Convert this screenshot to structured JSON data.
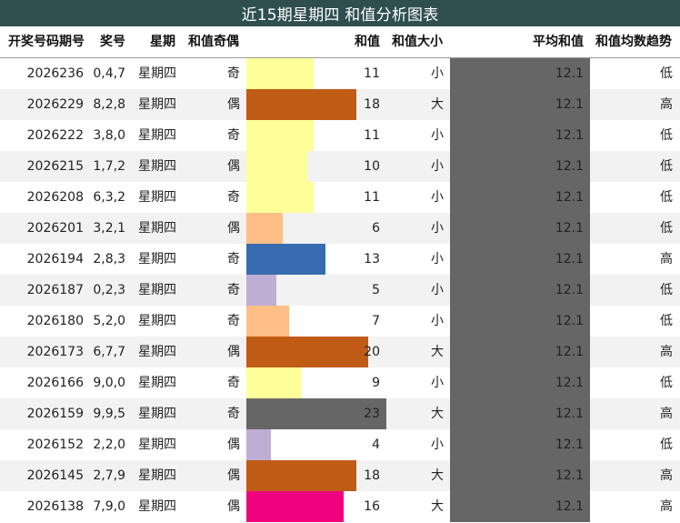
{
  "title": "近15期星期四 和值分析图表",
  "headers": {
    "issue": "开奖号码期号",
    "numbers": "奖号",
    "weekday": "星期",
    "parity": "和值奇偶",
    "sum": "和值",
    "size": "和值大小",
    "avg": "平均和值",
    "trend": "和值均数趋势"
  },
  "colors": {
    "title_bg": "#2f4f4f",
    "avg_bg": "#666666",
    "row_alt": "#f2f2f2"
  },
  "chart_data": {
    "type": "table",
    "title": "近15期星期四 和值分析图表",
    "sum_scale_max": 23,
    "columns": [
      "开奖号码期号",
      "奖号",
      "星期",
      "和值奇偶",
      "和值",
      "和值大小",
      "平均和值",
      "和值均数趋势"
    ],
    "rows": [
      {
        "issue": "2026236",
        "numbers": "0,4,7",
        "weekday": "星期四",
        "parity": "奇",
        "sum": 11,
        "size": "小",
        "avg": "12.1",
        "trend": "低",
        "bar_color": "#ffff99"
      },
      {
        "issue": "2026229",
        "numbers": "8,2,8",
        "weekday": "星期四",
        "parity": "偶",
        "sum": 18,
        "size": "大",
        "avg": "12.1",
        "trend": "高",
        "bar_color": "#c05c16"
      },
      {
        "issue": "2026222",
        "numbers": "3,8,0",
        "weekday": "星期四",
        "parity": "奇",
        "sum": 11,
        "size": "小",
        "avg": "12.1",
        "trend": "低",
        "bar_color": "#ffff99"
      },
      {
        "issue": "2026215",
        "numbers": "1,7,2",
        "weekday": "星期四",
        "parity": "偶",
        "sum": 10,
        "size": "小",
        "avg": "12.1",
        "trend": "低",
        "bar_color": "#ffff99"
      },
      {
        "issue": "2026208",
        "numbers": "6,3,2",
        "weekday": "星期四",
        "parity": "奇",
        "sum": 11,
        "size": "小",
        "avg": "12.1",
        "trend": "低",
        "bar_color": "#ffff99"
      },
      {
        "issue": "2026201",
        "numbers": "3,2,1",
        "weekday": "星期四",
        "parity": "偶",
        "sum": 6,
        "size": "小",
        "avg": "12.1",
        "trend": "低",
        "bar_color": "#fdbf85"
      },
      {
        "issue": "2026194",
        "numbers": "2,8,3",
        "weekday": "星期四",
        "parity": "奇",
        "sum": 13,
        "size": "小",
        "avg": "12.1",
        "trend": "高",
        "bar_color": "#386cb0"
      },
      {
        "issue": "2026187",
        "numbers": "0,2,3",
        "weekday": "星期四",
        "parity": "奇",
        "sum": 5,
        "size": "小",
        "avg": "12.1",
        "trend": "低",
        "bar_color": "#beaed4"
      },
      {
        "issue": "2026180",
        "numbers": "5,2,0",
        "weekday": "星期四",
        "parity": "奇",
        "sum": 7,
        "size": "小",
        "avg": "12.1",
        "trend": "低",
        "bar_color": "#fdbf85"
      },
      {
        "issue": "2026173",
        "numbers": "6,7,7",
        "weekday": "星期四",
        "parity": "偶",
        "sum": 20,
        "size": "大",
        "avg": "12.1",
        "trend": "高",
        "bar_color": "#c05c16"
      },
      {
        "issue": "2026166",
        "numbers": "9,0,0",
        "weekday": "星期四",
        "parity": "奇",
        "sum": 9,
        "size": "小",
        "avg": "12.1",
        "trend": "低",
        "bar_color": "#ffff99"
      },
      {
        "issue": "2026159",
        "numbers": "9,9,5",
        "weekday": "星期四",
        "parity": "奇",
        "sum": 23,
        "size": "大",
        "avg": "12.1",
        "trend": "高",
        "bar_color": "#666666"
      },
      {
        "issue": "2026152",
        "numbers": "2,2,0",
        "weekday": "星期四",
        "parity": "偶",
        "sum": 4,
        "size": "小",
        "avg": "12.1",
        "trend": "低",
        "bar_color": "#beaed4"
      },
      {
        "issue": "2026145",
        "numbers": "2,7,9",
        "weekday": "星期四",
        "parity": "偶",
        "sum": 18,
        "size": "大",
        "avg": "12.1",
        "trend": "高",
        "bar_color": "#c05c16"
      },
      {
        "issue": "2026138",
        "numbers": "7,9,0",
        "weekday": "星期四",
        "parity": "偶",
        "sum": 16,
        "size": "大",
        "avg": "12.1",
        "trend": "高",
        "bar_color": "#f0027f"
      }
    ]
  }
}
